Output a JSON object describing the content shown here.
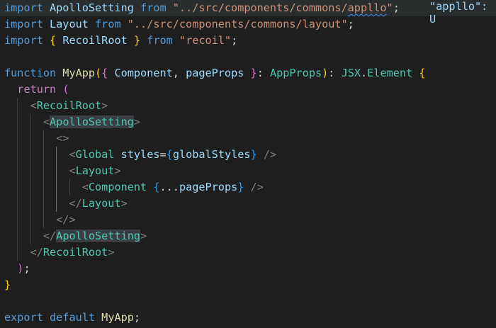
{
  "lines": [
    {
      "t": [
        {
          "c": "kw",
          "v": "import "
        },
        {
          "c": "var",
          "v": "ApolloSetting"
        },
        {
          "c": "kw",
          "v": " from "
        },
        {
          "c": "str",
          "v": "\"../src/components/commons/"
        },
        {
          "c": "str squig",
          "v": "appllo"
        },
        {
          "c": "str",
          "v": "\""
        },
        {
          "c": "plain",
          "v": ";"
        }
      ]
    },
    {
      "t": [
        {
          "c": "kw",
          "v": "import "
        },
        {
          "c": "var",
          "v": "Layout"
        },
        {
          "c": "kw",
          "v": " from "
        },
        {
          "c": "str",
          "v": "\"../src/components/commons/layout\""
        },
        {
          "c": "plain",
          "v": ";"
        }
      ]
    },
    {
      "t": [
        {
          "c": "kw",
          "v": "import "
        },
        {
          "c": "b1",
          "v": "{ "
        },
        {
          "c": "var",
          "v": "RecoilRoot"
        },
        {
          "c": "b1",
          "v": " }"
        },
        {
          "c": "kw",
          "v": " from "
        },
        {
          "c": "str",
          "v": "\"recoil\""
        },
        {
          "c": "plain",
          "v": ";"
        }
      ]
    },
    {
      "t": []
    },
    {
      "t": [
        {
          "c": "kw",
          "v": "function "
        },
        {
          "c": "fn",
          "v": "MyApp"
        },
        {
          "c": "b1",
          "v": "("
        },
        {
          "c": "b2",
          "v": "{ "
        },
        {
          "c": "var",
          "v": "Component"
        },
        {
          "c": "plain",
          "v": ", "
        },
        {
          "c": "var",
          "v": "pageProps"
        },
        {
          "c": "b2",
          "v": " }"
        },
        {
          "c": "plain",
          "v": ": "
        },
        {
          "c": "type",
          "v": "AppProps"
        },
        {
          "c": "b1",
          "v": ")"
        },
        {
          "c": "plain",
          "v": ": "
        },
        {
          "c": "type",
          "v": "JSX"
        },
        {
          "c": "plain",
          "v": "."
        },
        {
          "c": "type",
          "v": "Element"
        },
        {
          "c": "plain",
          "v": " "
        },
        {
          "c": "b1",
          "v": "{"
        }
      ]
    },
    {
      "t": [
        {
          "c": "plain",
          "v": "  "
        },
        {
          "c": "ctrl",
          "v": "return"
        },
        {
          "c": "plain",
          "v": " "
        },
        {
          "c": "b2",
          "v": "("
        }
      ]
    },
    {
      "t": [
        {
          "c": "plain",
          "v": "    "
        },
        {
          "c": "punc",
          "v": "<"
        },
        {
          "c": "tag",
          "v": "RecoilRoot"
        },
        {
          "c": "punc",
          "v": ">"
        }
      ]
    },
    {
      "t": [
        {
          "c": "plain",
          "v": "      "
        },
        {
          "c": "punc",
          "v": "<"
        },
        {
          "c": "tag hl",
          "v": "ApolloSetting"
        },
        {
          "c": "punc",
          "v": ">"
        }
      ]
    },
    {
      "t": [
        {
          "c": "plain",
          "v": "        "
        },
        {
          "c": "punc",
          "v": "<>"
        }
      ]
    },
    {
      "t": [
        {
          "c": "plain",
          "v": "          "
        },
        {
          "c": "punc",
          "v": "<"
        },
        {
          "c": "tag",
          "v": "Global"
        },
        {
          "c": "plain",
          "v": " "
        },
        {
          "c": "var",
          "v": "styles"
        },
        {
          "c": "plain",
          "v": "="
        },
        {
          "c": "b3",
          "v": "{"
        },
        {
          "c": "var",
          "v": "globalStyles"
        },
        {
          "c": "b3",
          "v": "}"
        },
        {
          "c": "plain",
          "v": " "
        },
        {
          "c": "punc",
          "v": "/>"
        }
      ]
    },
    {
      "t": [
        {
          "c": "plain",
          "v": "          "
        },
        {
          "c": "punc",
          "v": "<"
        },
        {
          "c": "tag",
          "v": "Layout"
        },
        {
          "c": "punc",
          "v": ">"
        }
      ]
    },
    {
      "t": [
        {
          "c": "plain",
          "v": "            "
        },
        {
          "c": "punc",
          "v": "<"
        },
        {
          "c": "tag",
          "v": "Component"
        },
        {
          "c": "plain",
          "v": " "
        },
        {
          "c": "b3",
          "v": "{"
        },
        {
          "c": "plain",
          "v": "..."
        },
        {
          "c": "var",
          "v": "pageProps"
        },
        {
          "c": "b3",
          "v": "}"
        },
        {
          "c": "plain",
          "v": " "
        },
        {
          "c": "punc",
          "v": "/>"
        }
      ]
    },
    {
      "t": [
        {
          "c": "plain",
          "v": "          "
        },
        {
          "c": "punc",
          "v": "</"
        },
        {
          "c": "tag",
          "v": "Layout"
        },
        {
          "c": "punc",
          "v": ">"
        }
      ]
    },
    {
      "t": [
        {
          "c": "plain",
          "v": "        "
        },
        {
          "c": "punc",
          "v": "</>"
        }
      ]
    },
    {
      "t": [
        {
          "c": "plain",
          "v": "      "
        },
        {
          "c": "punc",
          "v": "</"
        },
        {
          "c": "tag hl",
          "v": "ApolloSetting"
        },
        {
          "c": "punc",
          "v": ">"
        }
      ]
    },
    {
      "t": [
        {
          "c": "plain",
          "v": "    "
        },
        {
          "c": "punc",
          "v": "</"
        },
        {
          "c": "tag",
          "v": "RecoilRoot"
        },
        {
          "c": "punc",
          "v": ">"
        }
      ]
    },
    {
      "t": [
        {
          "c": "plain",
          "v": "  "
        },
        {
          "c": "b2",
          "v": ")"
        },
        {
          "c": "plain",
          "v": ";"
        }
      ]
    },
    {
      "t": [
        {
          "c": "b1",
          "v": "}"
        }
      ]
    },
    {
      "t": []
    },
    {
      "t": [
        {
          "c": "kw",
          "v": "export "
        },
        {
          "c": "kw",
          "v": "default "
        },
        {
          "c": "fn",
          "v": "MyApp"
        },
        {
          "c": "plain",
          "v": ";"
        }
      ]
    }
  ],
  "inline_hint": {
    "text": "\"appllo\": U"
  }
}
